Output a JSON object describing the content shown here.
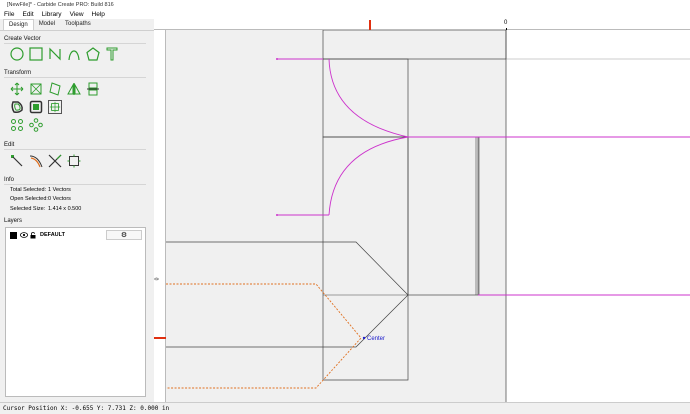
{
  "window": {
    "title": "[NewFile]* - Carbide Create PRO: Build 816"
  },
  "menu": [
    "File",
    "Edit",
    "Library",
    "View",
    "Help"
  ],
  "tabs": [
    "Design",
    "Model",
    "Toolpaths"
  ],
  "sections": {
    "create_vector": "Create Vector",
    "transform": "Transform",
    "edit": "Edit",
    "info": "Info",
    "layers": "Layers"
  },
  "icons": {
    "create": [
      "circle-icon",
      "rectangle-icon",
      "polyline-icon",
      "curve-icon",
      "polygon-icon",
      "text-icon"
    ],
    "transform_row1": [
      "move-icon",
      "scale-icon",
      "rotate-icon",
      "mirror-icon",
      "align-icon"
    ],
    "transform_row2": [
      "offset-icon",
      "boolean-icon",
      "group-icon"
    ],
    "transform_row3": [
      "array-icon",
      "circular-array-icon"
    ],
    "edit": [
      "node-edit-icon",
      "fillet-icon",
      "trim-icon",
      "bounding-box-icon"
    ]
  },
  "info": {
    "total_selected_label": "Total Selected:",
    "total_selected_value": "1 Vectors",
    "open_selected_label": "Open Selected:",
    "open_selected_value": "0 Vectors",
    "selected_size_label": "Selected Size:",
    "selected_size_value": "1.414 x 0.500"
  },
  "layers": [
    {
      "name": "DEFAULT",
      "visible": true,
      "locked": false
    }
  ],
  "ruler": {
    "h_origin_label": "0",
    "v_origin_label": "0"
  },
  "canvas": {
    "center_label": "Center"
  },
  "status": {
    "cursor_text": "Cursor Position X: -0.655 Y: 7.731 Z: 0.000 in"
  },
  "colors": {
    "accent": "#2e9d2e",
    "magenta": "#cc33cc",
    "orange": "#e07020",
    "marker": "#e03010"
  }
}
